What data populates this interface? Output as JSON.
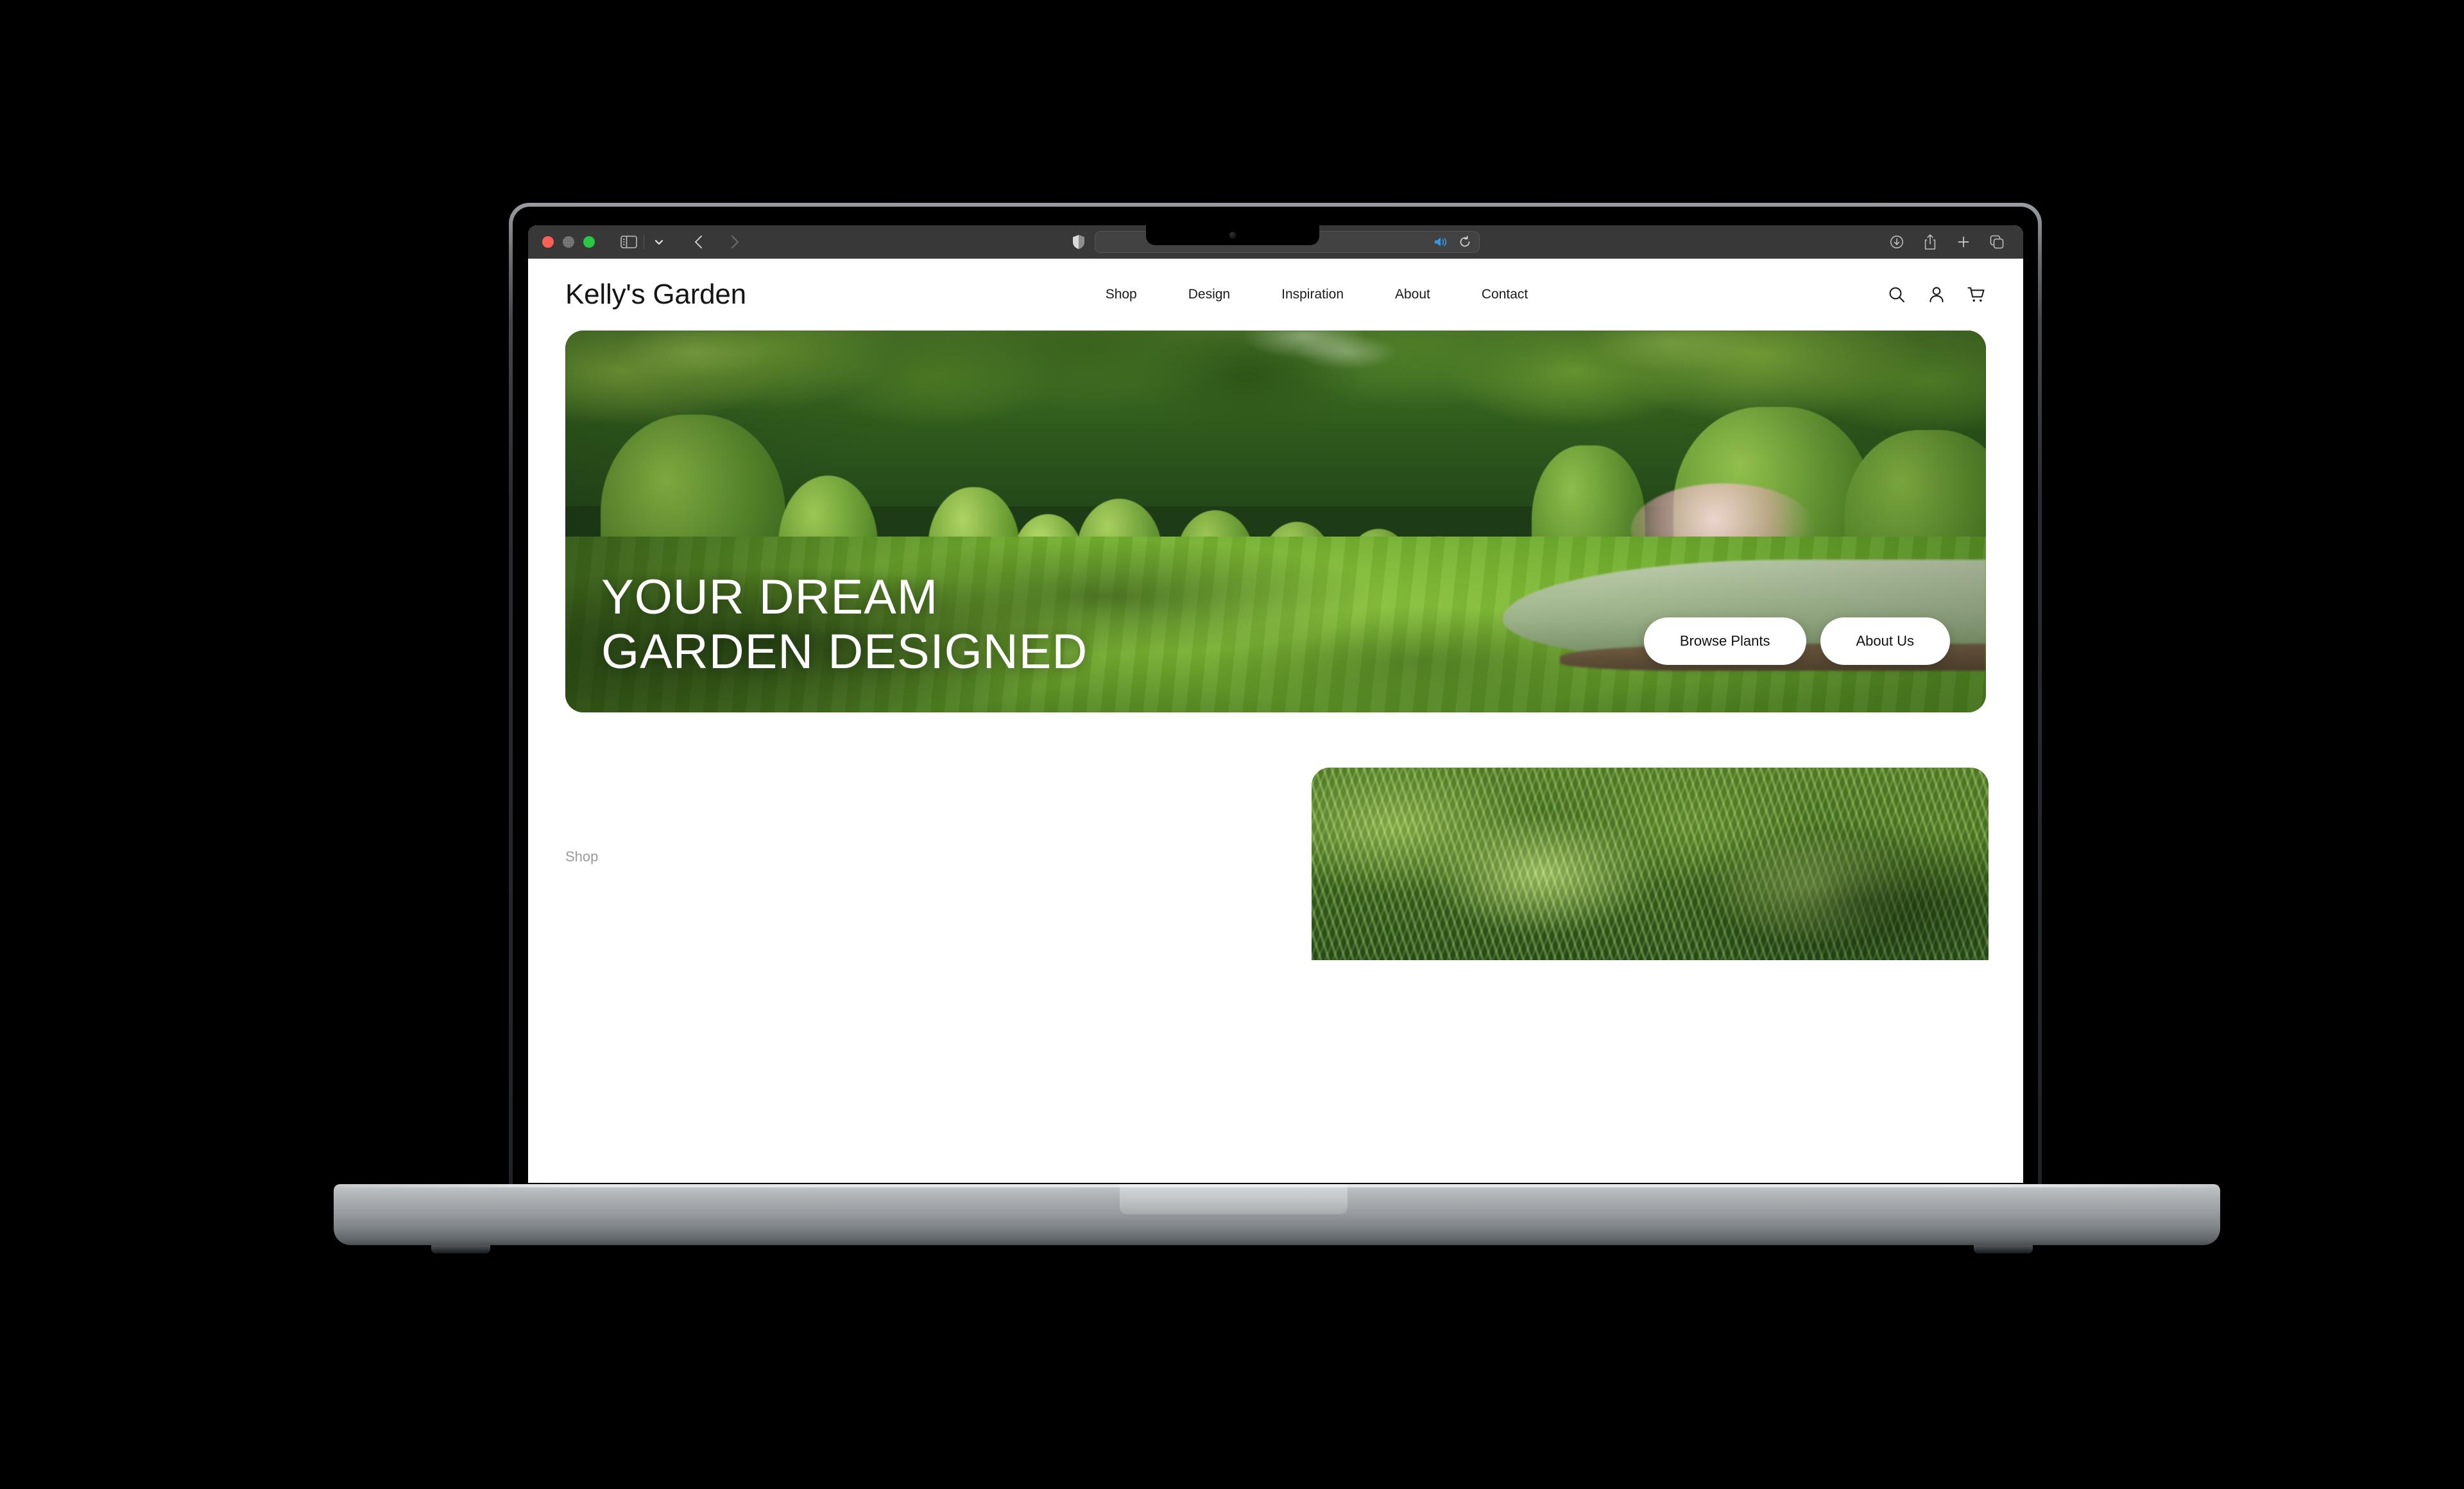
{
  "browser": {
    "traffic_lights": [
      "close-red",
      "minimize-yellow",
      "maximize-green"
    ],
    "sidebar_toggle": "sidebar-icon",
    "tab_group_chevron": "chevron-down-icon",
    "back": "back-arrow-icon",
    "forward": "forward-arrow-icon",
    "privacy_shield": "shield-icon",
    "address_value": "",
    "address_placeholder": "",
    "audio_icon": "speaker-icon",
    "reload_icon": "reload-icon",
    "downloads_icon": "downloads-icon",
    "share_icon": "share-icon",
    "new_tab_icon": "plus-icon",
    "tab_overview_icon": "tab-overview-icon",
    "accent_blue": "#2f9bf0",
    "chrome_bg": "#383838"
  },
  "site": {
    "logo": "Kelly's Garden",
    "nav": [
      {
        "label": "Shop"
      },
      {
        "label": "Design"
      },
      {
        "label": "Inspiration"
      },
      {
        "label": "About"
      },
      {
        "label": "Contact"
      }
    ],
    "header_icons": [
      {
        "name": "search-icon"
      },
      {
        "name": "account-icon"
      },
      {
        "name": "cart-icon"
      }
    ],
    "hero": {
      "headline_line1": "YOUR DREAM",
      "headline_line2": "GARDEN DESIGNED",
      "buttons": [
        {
          "label": "Browse Plants"
        },
        {
          "label": "About Us"
        }
      ],
      "image_alt": "Formal garden with topiary hedges, flower beds and manicured lawn"
    },
    "lower": {
      "section_label": "Shop",
      "card_image_alt": "Green ferns close-up"
    },
    "colors": {
      "text": "#141414",
      "muted": "#9a9a9a",
      "page_bg": "#ffffff",
      "button_bg": "#ffffff"
    }
  },
  "device": {
    "type": "laptop",
    "body_color": "#9a9ea2",
    "screen_bg": "#000000"
  }
}
